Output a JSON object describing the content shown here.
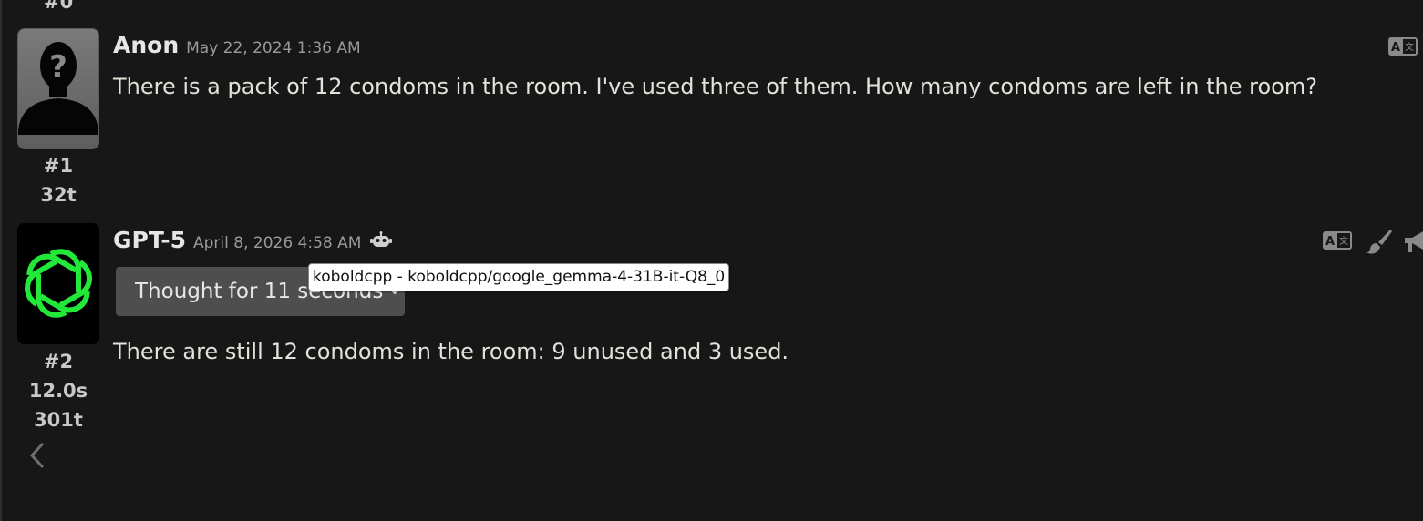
{
  "previous_message": {
    "number_label": "#0"
  },
  "messages": [
    {
      "author": "Anon",
      "date": "May 22, 2024 1:36 AM",
      "text": "There is a pack of 12 condoms in the room. I've used three of them. How many condoms are left in the room?",
      "number_label": "#1",
      "token_label": "32t",
      "avatar_icon": "anonymous-silhouette-icon",
      "action_icons": [
        "translate-icon"
      ]
    },
    {
      "author": "GPT-5",
      "date": "April 8, 2026 4:58 AM",
      "model_icon": "robot-icon",
      "reasoning_label": "Thought for 11 seconds",
      "tooltip": "koboldcpp - koboldcpp/google_gemma-4-31B-it-Q8_0",
      "text": "There are still 12 condoms in the room: 9 unused and 3 used.",
      "number_label": "#2",
      "time_label": "12.0s",
      "token_label": "301t",
      "avatar_icon": "openai-logo-icon",
      "avatar_color": "#22e83a",
      "action_icons": [
        "translate-icon",
        "paintbrush-icon",
        "megaphone-icon"
      ]
    }
  ],
  "navigation": {
    "back_icon": "chevron-left-icon"
  }
}
